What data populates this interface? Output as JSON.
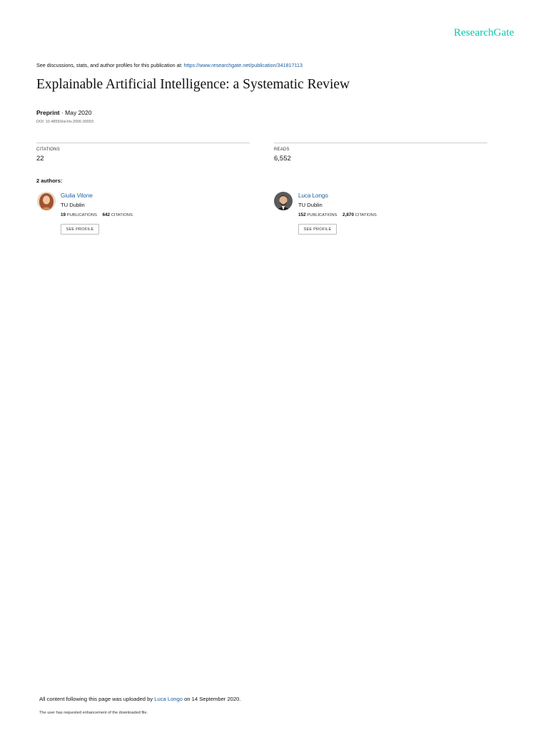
{
  "header": {
    "brand": "ResearchGate"
  },
  "intro": {
    "prefix": "See discussions, stats, and author profiles for this publication at: ",
    "url": "https://www.researchgate.net/publication/341817113"
  },
  "publication": {
    "title": "Explainable Artificial Intelligence: a Systematic Review",
    "type": "Preprint",
    "date_sep": " · ",
    "date": "May 2020",
    "doi": "DOI: 10.48550/arXiv.2006.00093"
  },
  "stats": {
    "citations_label": "CITATIONS",
    "citations_value": "22",
    "reads_label": "READS",
    "reads_value": "6,552"
  },
  "authors_heading": "2 authors:",
  "authors": [
    {
      "name": "Giulia Vilone",
      "institution": "TU Dublin",
      "publications": "19",
      "publications_label": "PUBLICATIONS",
      "citations": "642",
      "citations_label": "CITATIONS",
      "button_label": "SEE PROFILE"
    },
    {
      "name": "Luca Longo",
      "institution": "TU Dublin",
      "publications": "152",
      "publications_label": "PUBLICATIONS",
      "citations": "2,870",
      "citations_label": "CITATIONS",
      "button_label": "SEE PROFILE"
    }
  ],
  "footer": {
    "upload_prefix": "All content following this page was uploaded by ",
    "uploader": "Luca Longo",
    "upload_suffix": " on 14 September 2020.",
    "note": "The user has requested enhancement of the downloaded file."
  },
  "colors": {
    "brand": "#00c9ad",
    "link": "#1a5b9a"
  }
}
